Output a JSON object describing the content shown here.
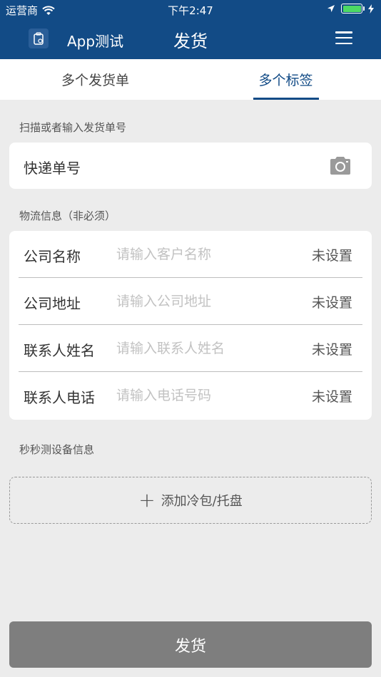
{
  "status": {
    "carrier": "运营商",
    "time": "下午2:47"
  },
  "navbar": {
    "app_name": "App测试",
    "title": "发货"
  },
  "tabs": [
    {
      "label": "多个发货单",
      "active": false
    },
    {
      "label": "多个标签",
      "active": true
    }
  ],
  "scan": {
    "section_label": "扫描或者输入发货单号",
    "field_label": "快递单号"
  },
  "logistics": {
    "section_label": "物流信息（非必须）",
    "rows": [
      {
        "label": "公司名称",
        "placeholder": "请输入客户名称",
        "action": "未设置"
      },
      {
        "label": "公司地址",
        "placeholder": "请输入公司地址",
        "action": "未设置"
      },
      {
        "label": "联系人姓名",
        "placeholder": "请输入联系人姓名",
        "action": "未设置"
      },
      {
        "label": "联系人电话",
        "placeholder": "请输入电话号码",
        "action": "未设置"
      }
    ]
  },
  "device": {
    "section_label": "秒秒测设备信息",
    "add_label": "添加冷包/托盘"
  },
  "submit_label": "发货",
  "colors": {
    "primary": "#124b86",
    "background": "#ececec",
    "button_disabled": "#7e7e7e",
    "battery": "#4cd964"
  }
}
